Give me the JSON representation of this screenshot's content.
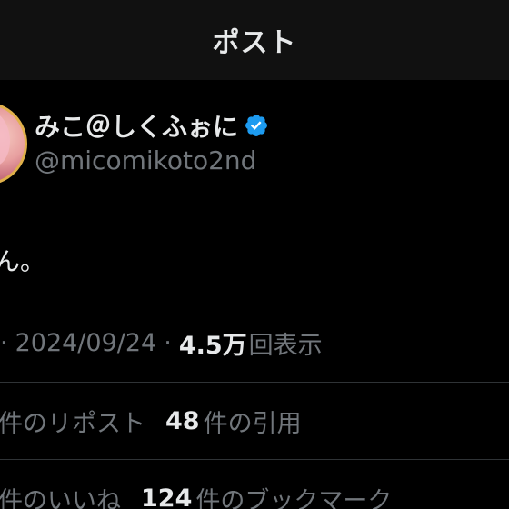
{
  "header": {
    "title": "ポスト"
  },
  "author": {
    "display_name": "みこ＠しくふぉに",
    "handle": "@micomikoto2nd",
    "verified_icon": "verified-badge-icon",
    "verified_color": "#1d9bf0"
  },
  "post": {
    "text": "ん。"
  },
  "meta": {
    "leading_sep": "·",
    "date": "2024/09/24",
    "sep": "·",
    "views_count": "4.5万",
    "views_label": "回表示"
  },
  "stats": {
    "reposts_label": "件のリポスト",
    "quotes_count": "48",
    "quotes_label": "件の引用",
    "likes_label": "件のいいね",
    "bookmarks_count": "124",
    "bookmarks_label": "件のブックマーク"
  },
  "colors": {
    "background": "#000000",
    "header_background": "#111111",
    "text_primary": "#e7e9ea",
    "text_secondary": "#71767b",
    "divider": "#2f3336"
  }
}
